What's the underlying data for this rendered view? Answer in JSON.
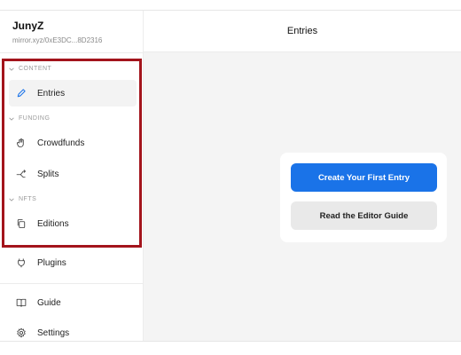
{
  "site": {
    "title": "JunyZ",
    "url": "mirror.xyz/0xE3DC...8D2316"
  },
  "sidebar": {
    "sections": [
      {
        "label": "CONTENT"
      },
      {
        "label": "FUNDING"
      },
      {
        "label": "NFTS"
      }
    ],
    "items": [
      {
        "label": "Entries",
        "icon": "pencil-icon",
        "active": true
      },
      {
        "label": "Crowdfunds",
        "icon": "hand-icon"
      },
      {
        "label": "Splits",
        "icon": "split-icon"
      },
      {
        "label": "Editions",
        "icon": "copy-icon"
      },
      {
        "label": "Plugins",
        "icon": "plug-icon"
      },
      {
        "label": "Guide",
        "icon": "book-icon"
      },
      {
        "label": "Settings",
        "icon": "gear-icon"
      }
    ]
  },
  "main": {
    "title": "Entries",
    "primary_button": "Create Your First Entry",
    "secondary_button": "Read the Editor Guide"
  },
  "colors": {
    "accent": "#1a73e8",
    "highlight": "#a3141c"
  }
}
